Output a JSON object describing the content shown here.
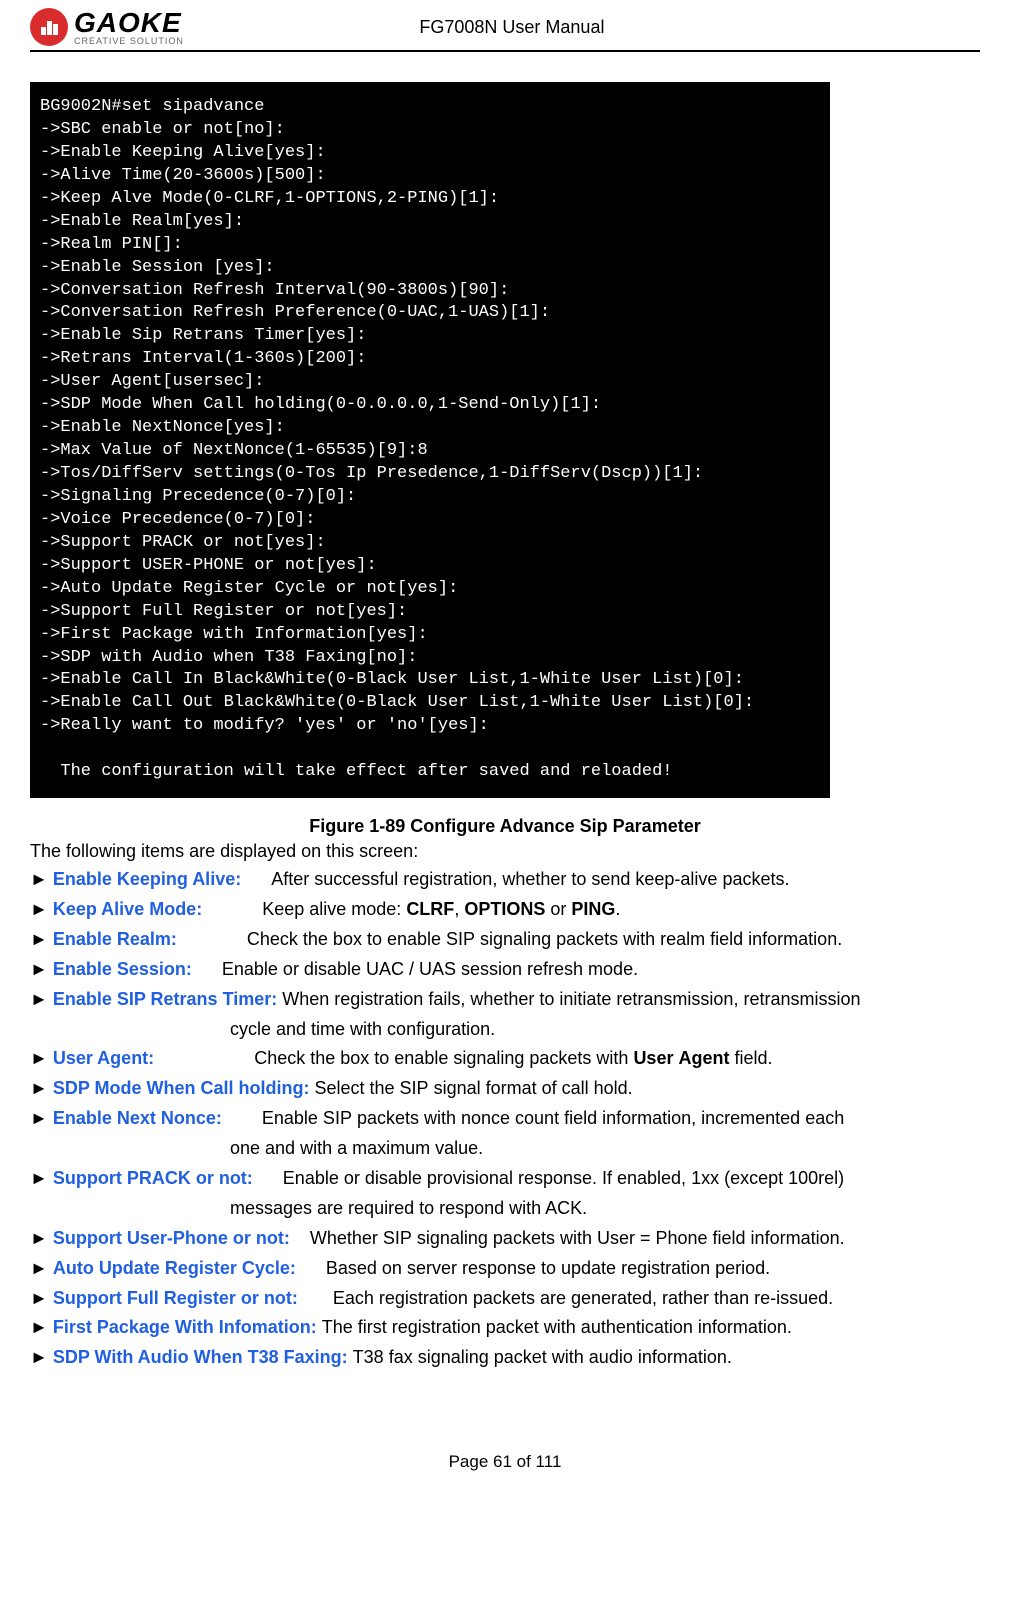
{
  "header": {
    "logo_text": "GAOKE",
    "logo_tag": "CREATIVE SOLUTION",
    "doc_title": "FG7008N User Manual"
  },
  "terminal_lines": [
    "BG9002N#set sipadvance",
    "->SBC enable or not[no]:",
    "->Enable Keeping Alive[yes]:",
    "->Alive Time(20-3600s)[500]:",
    "->Keep Alve Mode(0-CLRF,1-OPTIONS,2-PING)[1]:",
    "->Enable Realm[yes]:",
    "->Realm PIN[]:",
    "->Enable Session [yes]:",
    "->Conversation Refresh Interval(90-3800s)[90]:",
    "->Conversation Refresh Preference(0-UAC,1-UAS)[1]:",
    "->Enable Sip Retrans Timer[yes]:",
    "->Retrans Interval(1-360s)[200]:",
    "->User Agent[usersec]:",
    "->SDP Mode When Call holding(0-0.0.0.0,1-Send-Only)[1]:",
    "->Enable NextNonce[yes]:",
    "->Max Value of NextNonce(1-65535)[9]:8",
    "->Tos/DiffServ settings(0-Tos Ip Presedence,1-DiffServ(Dscp))[1]:",
    "->Signaling Precedence(0-7)[0]:",
    "->Voice Precedence(0-7)[0]:",
    "->Support PRACK or not[yes]:",
    "->Support USER-PHONE or not[yes]:",
    "->Auto Update Register Cycle or not[yes]:",
    "->Support Full Register or not[yes]:",
    "->First Package with Information[yes]:",
    "->SDP with Audio when T38 Faxing[no]:",
    "->Enable Call In Black&White(0-Black User List,1-White User List)[0]:",
    "->Enable Call Out Black&White(0-Black User List,1-White User List)[0]:",
    "->Really want to modify? 'yes' or 'no'[yes]:",
    "",
    "  The configuration will take effect after saved and reloaded!"
  ],
  "figure_caption": "Figure 1-89    Configure Advance Sip Parameter",
  "intro": "The following items are displayed on this screen:",
  "items": [
    {
      "key": "Enable Keeping Alive:",
      "desc": "      After successful registration, whether to send keep-alive packets."
    },
    {
      "key": "Keep Alive Mode:",
      "desc": "            Keep alive mode: <b>CLRF</b>, <b>OPTIONS</b> or <b>PING</b>."
    },
    {
      "key": "Enable Realm:",
      "desc": "              Check the box to enable SIP signaling packets with realm field information."
    },
    {
      "key": "Enable Session:",
      "desc": "      Enable or disable UAC / UAS session refresh mode."
    },
    {
      "key": "Enable SIP Retrans Timer:",
      "desc": " When registration fails, whether to initiate retransmission, retransmission",
      "cont": "cycle and time with configuration."
    },
    {
      "key": "User Agent:",
      "desc": "                    Check the box to enable signaling packets with <b>User Agent</b> field."
    },
    {
      "key": "SDP Mode When Call holding:",
      "desc": " Select the SIP signal format of call hold."
    },
    {
      "key": "Enable Next Nonce:",
      "desc": "        Enable SIP packets with nonce count field information, incremented each",
      "cont": "one and with a maximum value."
    },
    {
      "key": "Support PRACK or not:",
      "desc": "      Enable or disable provisional response. If enabled, 1xx (except 100rel)",
      "cont": "messages are required to respond with ACK."
    },
    {
      "key": "Support User-Phone or not:",
      "desc": "    Whether SIP signaling packets with User = Phone field information."
    },
    {
      "key": "Auto Update Register Cycle:",
      "desc": "      Based on server response to update registration period."
    },
    {
      "key": "Support Full Register or not:",
      "desc": "       Each registration packets are generated, rather than re-issued."
    },
    {
      "key": "First Package With Infomation:",
      "desc": " The first registration packet with authentication information."
    },
    {
      "key": "SDP With Audio When T38 Faxing:",
      "desc": " T38 fax signaling packet with audio information."
    }
  ],
  "footer": "Page 61 of 111"
}
